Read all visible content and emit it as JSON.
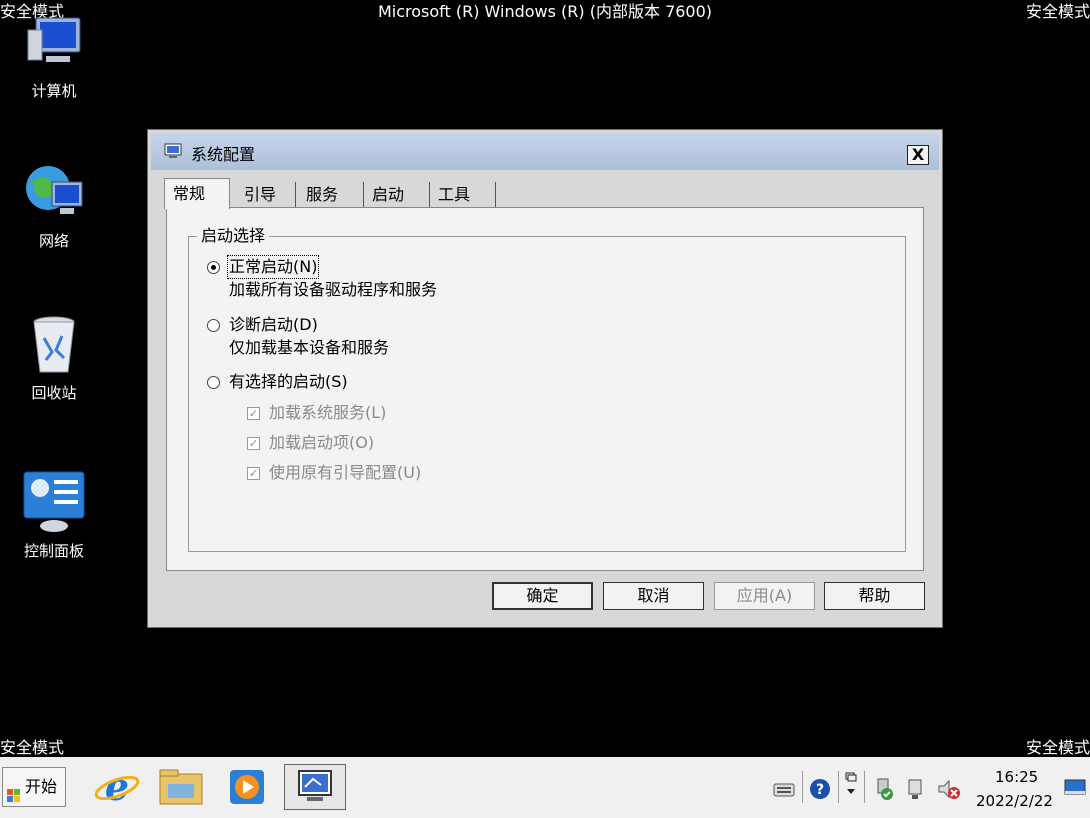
{
  "screen": {
    "top_title": "Microsoft (R) Windows (R) (内部版本 7600)",
    "safe_mode_label": "安全模式"
  },
  "desktop_icons": [
    {
      "label": "计算机",
      "icon": "computer-icon"
    },
    {
      "label": "网络",
      "icon": "network-icon"
    },
    {
      "label": "回收站",
      "icon": "recycle-bin-icon"
    },
    {
      "label": "控制面板",
      "icon": "control-panel-icon"
    }
  ],
  "dialog": {
    "title": "系统配置",
    "close_label": "X",
    "tabs": [
      {
        "label": "常规",
        "active": true
      },
      {
        "label": "引导",
        "active": false
      },
      {
        "label": "服务",
        "active": false
      },
      {
        "label": "启动",
        "active": false
      },
      {
        "label": "工具",
        "active": false
      }
    ],
    "group_label": "启动选择",
    "options": [
      {
        "label": "正常启动(N)",
        "description": "加载所有设备驱动程序和服务",
        "selected": true
      },
      {
        "label": "诊断启动(D)",
        "description": "仅加载基本设备和服务",
        "selected": false
      },
      {
        "label": "有选择的启动(S)",
        "description": "",
        "selected": false
      }
    ],
    "checkboxes": [
      {
        "label": "加载系统服务(L)",
        "checked": true,
        "enabled": false
      },
      {
        "label": "加载启动项(O)",
        "checked": true,
        "enabled": false
      },
      {
        "label": "使用原有引导配置(U)",
        "checked": true,
        "enabled": false
      }
    ],
    "buttons": {
      "ok": "确定",
      "cancel": "取消",
      "apply": "应用(A)",
      "help": "帮助"
    }
  },
  "taskbar": {
    "start_label": "开始",
    "apps": [
      "internet-explorer-icon",
      "file-explorer-icon",
      "media-player-icon",
      "system-config-icon"
    ],
    "tray_icons": [
      "keyboard-icon",
      "help-icon",
      "restore-icon",
      "usb-safe-remove-icon",
      "network-tray-icon",
      "volume-muted-icon"
    ],
    "time": "16:25",
    "date": "2022/2/22"
  },
  "colors": {
    "desktop": "#000000",
    "titlebar": "#b9c9e2",
    "dialog_face": "#f3f3f3",
    "taskbar": "#f0f0f0"
  }
}
